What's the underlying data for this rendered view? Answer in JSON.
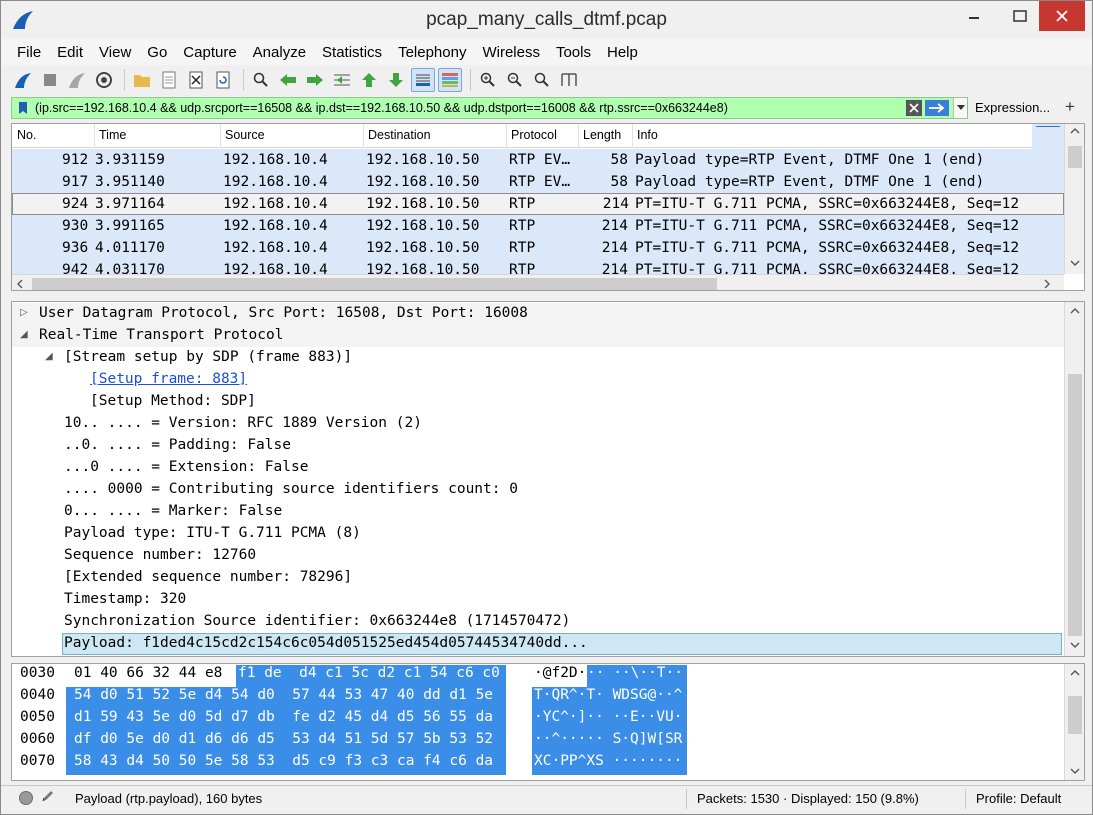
{
  "window": {
    "title": "pcap_many_calls_dtmf.pcap"
  },
  "menu": [
    {
      "label": "File"
    },
    {
      "label": "Edit"
    },
    {
      "label": "View"
    },
    {
      "label": "Go"
    },
    {
      "label": "Capture"
    },
    {
      "label": "Analyze"
    },
    {
      "label": "Statistics"
    },
    {
      "label": "Telephony"
    },
    {
      "label": "Wireless"
    },
    {
      "label": "Tools"
    },
    {
      "label": "Help"
    }
  ],
  "filter": {
    "value": "(ip.src==192.168.10.4 && udp.srcport==16508 && ip.dst==192.168.10.50 && udp.dstport==16008 && rtp.ssrc==0x663244e8)",
    "expression_label": "Expression...",
    "add_label": "+"
  },
  "packet_list": {
    "columns": [
      "No.",
      "Time",
      "Source",
      "Destination",
      "Protocol",
      "Length",
      "Info"
    ],
    "rows": [
      {
        "no": "912",
        "time": "3.931159",
        "src": "192.168.10.4",
        "dst": "192.168.10.50",
        "proto": "RTP EV…",
        "len": "58",
        "info": "Payload type=RTP Event, DTMF One 1 (end)"
      },
      {
        "no": "917",
        "time": "3.951140",
        "src": "192.168.10.4",
        "dst": "192.168.10.50",
        "proto": "RTP EV…",
        "len": "58",
        "info": "Payload type=RTP Event, DTMF One 1 (end)"
      },
      {
        "no": "924",
        "time": "3.971164",
        "src": "192.168.10.4",
        "dst": "192.168.10.50",
        "proto": "RTP",
        "len": "214",
        "info": "PT=ITU-T G.711 PCMA, SSRC=0x663244E8, Seq=12"
      },
      {
        "no": "930",
        "time": "3.991165",
        "src": "192.168.10.4",
        "dst": "192.168.10.50",
        "proto": "RTP",
        "len": "214",
        "info": "PT=ITU-T G.711 PCMA, SSRC=0x663244E8, Seq=12"
      },
      {
        "no": "936",
        "time": "4.011170",
        "src": "192.168.10.4",
        "dst": "192.168.10.50",
        "proto": "RTP",
        "len": "214",
        "info": "PT=ITU-T G.711 PCMA, SSRC=0x663244E8, Seq=12"
      },
      {
        "no": "942",
        "time": "4.031170",
        "src": "192.168.10.4",
        "dst": "192.168.10.50",
        "proto": "RTP",
        "len": "214",
        "info": "PT=ITU-T G.711 PCMA, SSRC=0x663244E8, Seq=12"
      }
    ]
  },
  "details": {
    "rows": [
      {
        "arrow": "▷",
        "text": "User Datagram Protocol, Src Port: 16508, Dst Port: 16008"
      },
      {
        "arrow": "◢",
        "text": "Real-Time Transport Protocol"
      },
      {
        "arrow": "◢",
        "text": "[Stream setup by SDP (frame 883)]"
      },
      {
        "text": "[Setup frame: 883]"
      },
      {
        "text": "[Setup Method: SDP]"
      },
      {
        "text": "10.. .... = Version: RFC 1889 Version (2)"
      },
      {
        "text": "..0. .... = Padding: False"
      },
      {
        "text": "...0 .... = Extension: False"
      },
      {
        "text": ".... 0000 = Contributing source identifiers count: 0"
      },
      {
        "text": "0... .... = Marker: False"
      },
      {
        "text": "Payload type: ITU-T G.711 PCMA (8)"
      },
      {
        "text": "Sequence number: 12760"
      },
      {
        "text": "[Extended sequence number: 78296]"
      },
      {
        "text": "Timestamp: 320"
      },
      {
        "text": "Synchronization Source identifier: 0x663244e8 (1714570472)"
      },
      {
        "text": "Payload: f1ded4c15cd2c154c6c054d051525ed454d05744534740dd..."
      }
    ]
  },
  "bytes": {
    "rows": [
      {
        "offset": "0030",
        "hex_plain": "01 40 66 32 44 e8 ",
        "hex_sel": "f1 de  d4 c1 5c d2 c1 54 c6 c0",
        "ascii_plain": "·@f2D·",
        "ascii_sel": "·· ··\\··T··"
      },
      {
        "offset": "0040",
        "hex_plain": "",
        "hex_sel": "54 d0 51 52 5e d4 54 d0  57 44 53 47 40 dd d1 5e",
        "ascii_plain": "",
        "ascii_sel": "T·QR^·T· WDSG@··^"
      },
      {
        "offset": "0050",
        "hex_plain": "",
        "hex_sel": "d1 59 43 5e d0 5d d7 db  fe d2 45 d4 d5 56 55 da",
        "ascii_plain": "",
        "ascii_sel": "·YC^·]·· ··E··VU·"
      },
      {
        "offset": "0060",
        "hex_plain": "",
        "hex_sel": "df d0 5e d0 d1 d6 d6 d5  53 d4 51 5d 57 5b 53 52",
        "ascii_plain": "",
        "ascii_sel": "··^····· S·Q]W[SR"
      },
      {
        "offset": "0070",
        "hex_plain": "",
        "hex_sel": "58 43 d4 50 50 5e 58 53  d5 c9 f3 c3 ca f4 c6 da",
        "ascii_plain": "",
        "ascii_sel": "XC·PP^XS ········"
      }
    ]
  },
  "status": {
    "field_info": "Payload (rtp.payload), 160 bytes",
    "packets": "Packets: 1530 · Displayed: 150 (9.8%)",
    "profile": "Profile: Default"
  },
  "colors": {
    "filter_ok": "#afffaf",
    "rtp_row": "#dae8fa",
    "byte_highlight": "#3b8ee8",
    "close_button": "#c7372f"
  }
}
